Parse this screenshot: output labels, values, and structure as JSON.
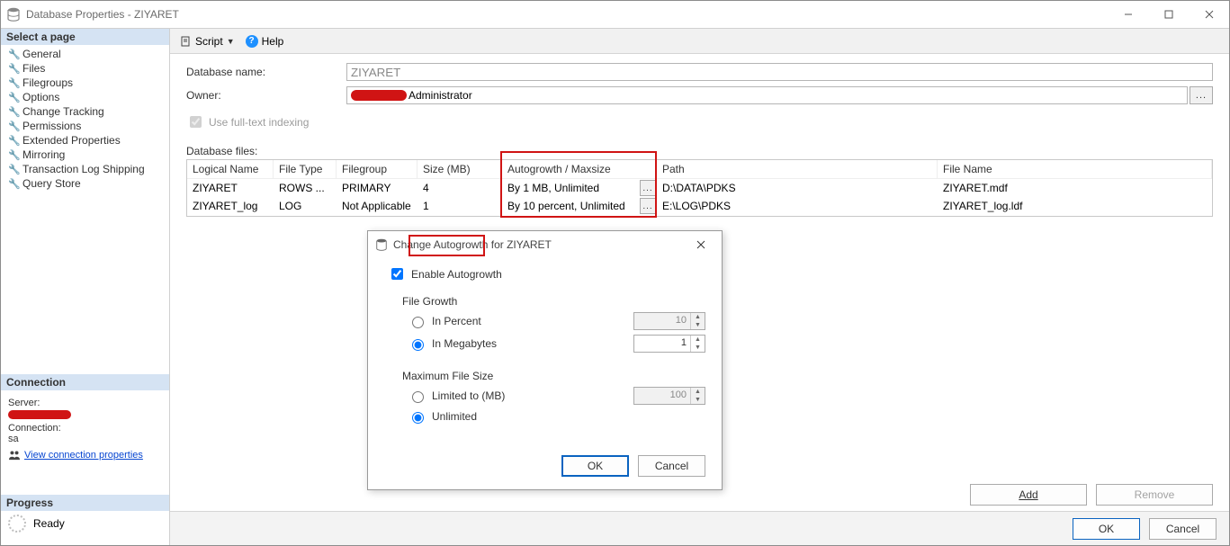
{
  "window": {
    "title": "Database Properties - ZIYARET"
  },
  "sidebar": {
    "selectPage": "Select a page",
    "pages": [
      "General",
      "Files",
      "Filegroups",
      "Options",
      "Change Tracking",
      "Permissions",
      "Extended Properties",
      "Mirroring",
      "Transaction Log Shipping",
      "Query Store"
    ],
    "connectionHeader": "Connection",
    "serverLabel": "Server:",
    "connectionLabel": "Connection:",
    "connectionValue": "sa",
    "viewConnProps": "View connection properties",
    "progressHeader": "Progress",
    "progressStatus": "Ready"
  },
  "toolbar": {
    "script": "Script",
    "help": "Help"
  },
  "form": {
    "dbNameLabel": "Database name:",
    "dbNameValue": "ZIYARET",
    "ownerLabel": "Owner:",
    "ownerValue": "Administrator",
    "fulltext": "Use full-text indexing",
    "dbFilesLabel": "Database files:"
  },
  "grid": {
    "headers": {
      "logical": "Logical Name",
      "filetype": "File Type",
      "filegroup": "Filegroup",
      "size": "Size (MB)",
      "autogrowth": "Autogrowth / Maxsize",
      "path": "Path",
      "filename": "File Name"
    },
    "rows": [
      {
        "logical": "ZIYARET",
        "filetype": "ROWS ...",
        "filegroup": "PRIMARY",
        "size": "4",
        "autogrowth": "By 1 MB, Unlimited",
        "path": "D:\\DATA\\PDKS",
        "filename": "ZIYARET.mdf"
      },
      {
        "logical": "ZIYARET_log",
        "filetype": "LOG",
        "filegroup": "Not Applicable",
        "size": "1",
        "autogrowth": "By 10 percent, Unlimited",
        "path": "E:\\LOG\\PDKS",
        "filename": "ZIYARET_log.ldf"
      }
    ]
  },
  "buttons": {
    "add": "Add",
    "remove": "Remove",
    "ok": "OK",
    "cancel": "Cancel",
    "ellipsis": "..."
  },
  "dialog": {
    "title": "Change Autogrowth for ZIYARET",
    "enable": "Enable Autogrowth",
    "fileGrowth": "File Growth",
    "inPercent": "In Percent",
    "inMegabytes": "In Megabytes",
    "percentValue": "10",
    "mbValue": "1",
    "maxFileSize": "Maximum File Size",
    "limitedTo": "Limited to (MB)",
    "limitedValue": "100",
    "unlimited": "Unlimited",
    "ok": "OK",
    "cancel": "Cancel"
  }
}
